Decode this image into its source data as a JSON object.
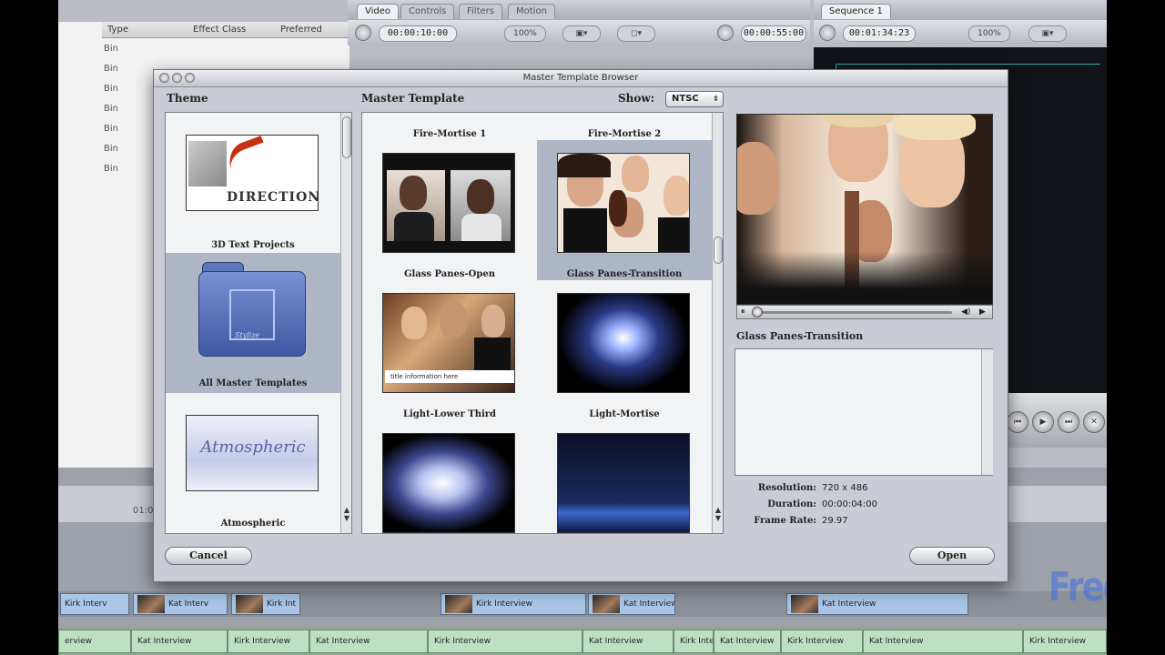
{
  "background_app": {
    "browser_columns": [
      "Type",
      "Effect Class",
      "Preferred"
    ],
    "bins": [
      "Bin",
      "Bin",
      "Bin",
      "Bin",
      "Bin",
      "Bin",
      "Bin"
    ],
    "viewer_tabs": [
      "Video",
      "Controls",
      "Filters",
      "Motion"
    ],
    "viewer_timecode_left": "00:00:10:00",
    "viewer_zoom": "100%",
    "viewer_timecode_right": "00:00:55:00",
    "canvas_tab": "Sequence 1",
    "canvas_timecode": "00:01:34:23",
    "canvas_zoom": "100%",
    "ruler_mark": "01:0",
    "video_clips": [
      "Kirk Interv",
      "Kat Interv",
      "Kirk Int",
      "Kirk Interview",
      "Kat Interview",
      "Kat Interview"
    ],
    "audio_clips": [
      "erview",
      "Kat Interview",
      "Kirk Interview",
      "Kat Interview",
      "Kirk Interview",
      "Kat Interview",
      "Kirk Interview",
      "Kat Interview",
      "Kirk Interview",
      "Kat Interview",
      "Kirk Interview"
    ]
  },
  "dialog": {
    "title": "Master Template Browser",
    "theme_header": "Theme",
    "template_header": "Master Template",
    "show_label": "Show:",
    "show_value": "NTSC",
    "themes": [
      {
        "label": "3D Text Projects",
        "thumb_text": "DIRECTIONS"
      },
      {
        "label": "All Master Templates",
        "thumb_text": "Stylize"
      },
      {
        "label": "Atmospheric",
        "thumb_text": "Atmospheric"
      }
    ],
    "templates": [
      {
        "label": "Fire-Mortise 1"
      },
      {
        "label": "Fire-Mortise 2"
      },
      {
        "label": "Glass Panes-Open",
        "thumb_text": "title information here"
      },
      {
        "label": "Glass Panes-Transition"
      },
      {
        "label": "Light-Lower Third"
      },
      {
        "label": "Light-Mortise"
      }
    ],
    "preview_title": "Glass Panes-Transition",
    "playback_progress": 0.0,
    "resolution_label": "Resolution:",
    "resolution_value": "720 x 486",
    "duration_label": "Duration:",
    "duration_value": "00:00:04:00",
    "framerate_label": "Frame Rate:",
    "framerate_value": "29.97",
    "cancel_label": "Cancel",
    "open_label": "Open"
  },
  "watermark": "FreeToShare",
  "colors": {
    "selection": "#aeb6c6",
    "dialog_bg": "#c9ccd4",
    "clip_video": "#a9c6e6",
    "clip_audio": "#bde0c2"
  }
}
